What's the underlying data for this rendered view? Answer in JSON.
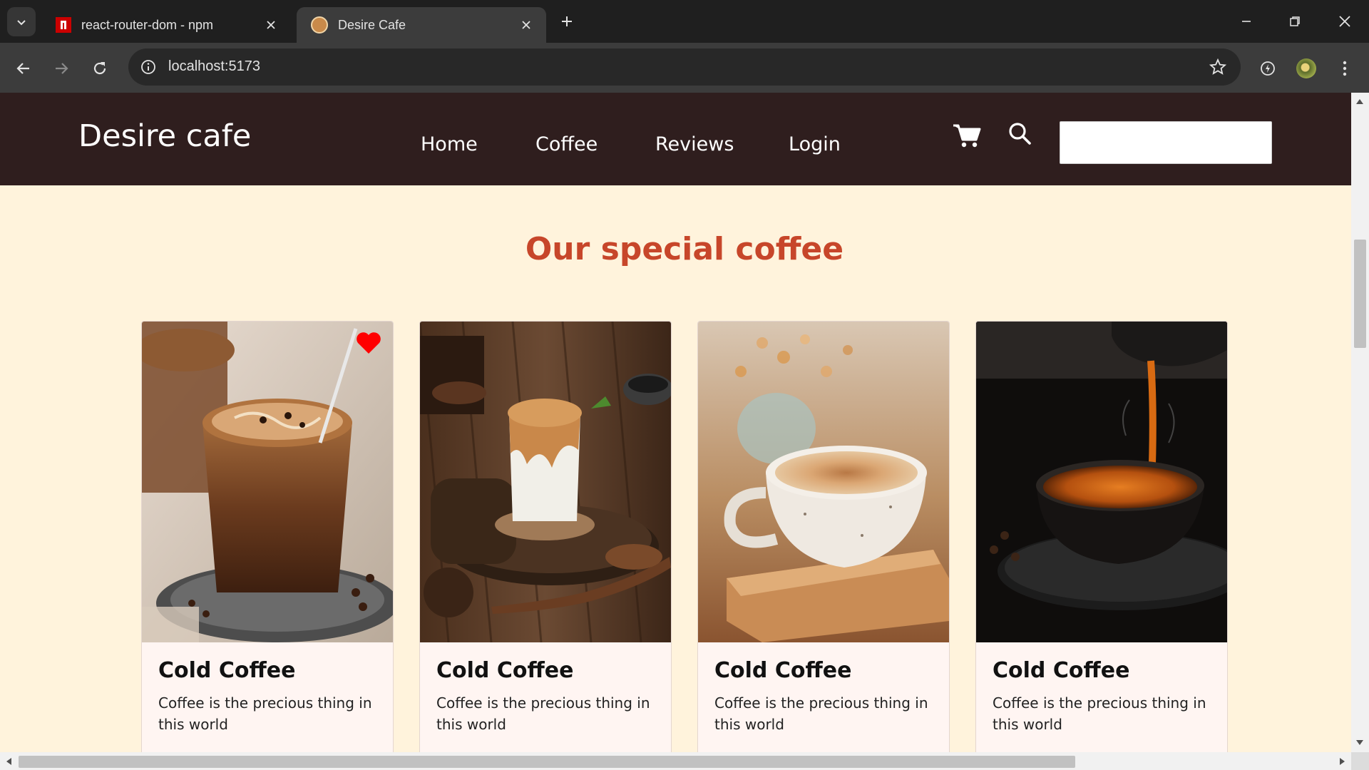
{
  "browser": {
    "tabs": [
      {
        "title": "react-router-dom - npm",
        "active": false,
        "favicon": "npm-favicon"
      },
      {
        "title": "Desire Cafe",
        "active": true,
        "favicon": "cafe-favicon"
      }
    ],
    "url": "localhost:5173"
  },
  "site": {
    "brand": "Desire cafe",
    "nav": [
      "Home",
      "Coffee",
      "Reviews",
      "Login"
    ],
    "search": {
      "value": "",
      "placeholder": ""
    },
    "section_title": "Our special coffee",
    "products": [
      {
        "name": "Cold Coffee",
        "description": "Coffee is the precious thing in this world",
        "favorited": true
      },
      {
        "name": "Cold Coffee",
        "description": "Coffee is the precious thing in this world",
        "favorited": false
      },
      {
        "name": "Cold Coffee",
        "description": "Coffee is the precious thing in this world",
        "favorited": false
      },
      {
        "name": "Cold Coffee",
        "description": "Coffee is the precious thing in this world",
        "favorited": false
      }
    ]
  },
  "colors": {
    "nav_background": "#2f1e1e",
    "page_background": "#fff3dc",
    "section_title": "#c7462a",
    "favorite_heart": "#ff0000"
  }
}
